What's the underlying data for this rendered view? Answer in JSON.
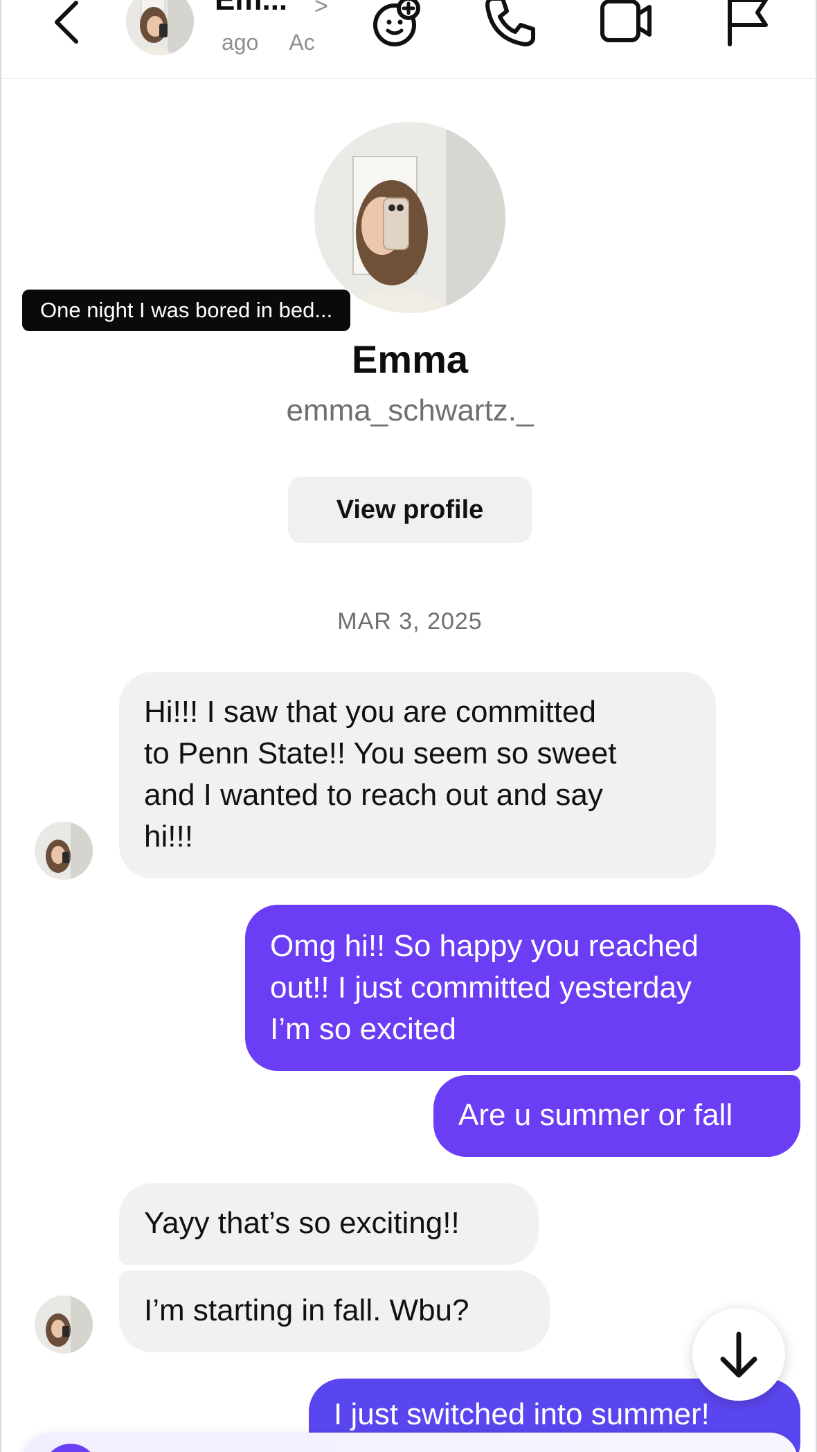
{
  "header": {
    "name": "Em...",
    "chevron": ">",
    "subtitle_left": "ago",
    "subtitle_right": "Ac"
  },
  "profile": {
    "caption": "One night I was bored in bed...",
    "name": "Emma",
    "handle": "emma_schwartz._",
    "view_profile_label": "View profile"
  },
  "date_separator": "MAR 3, 2025",
  "messages": [
    {
      "from": "them",
      "lines": [
        "Hi!!! I saw that you are committed",
        "to Penn State!! You seem so sweet",
        "and I wanted to reach out and say",
        "hi!!!"
      ]
    },
    {
      "from": "me",
      "lines": [
        "Omg hi!! So happy you reached",
        "out!! I just committed yesterday",
        "I’m so excited"
      ]
    },
    {
      "from": "me",
      "lines": [
        "Are u summer or fall"
      ]
    },
    {
      "from": "them",
      "lines": [
        "Yayy that’s so exciting!!"
      ]
    },
    {
      "from": "them",
      "lines": [
        "I’m starting in fall. Wbu?"
      ]
    },
    {
      "from": "me",
      "lines": [
        "I just switched into summer!"
      ]
    }
  ],
  "colors": {
    "sent_bubble": "#6b3ef5",
    "received_bubble": "#eff1f3",
    "caption_bg": "#0a0a0a"
  },
  "icons": [
    "back-arrow-icon",
    "game-icon",
    "phone-icon",
    "video-call-icon",
    "flag-icon",
    "arrow-down-icon"
  ]
}
